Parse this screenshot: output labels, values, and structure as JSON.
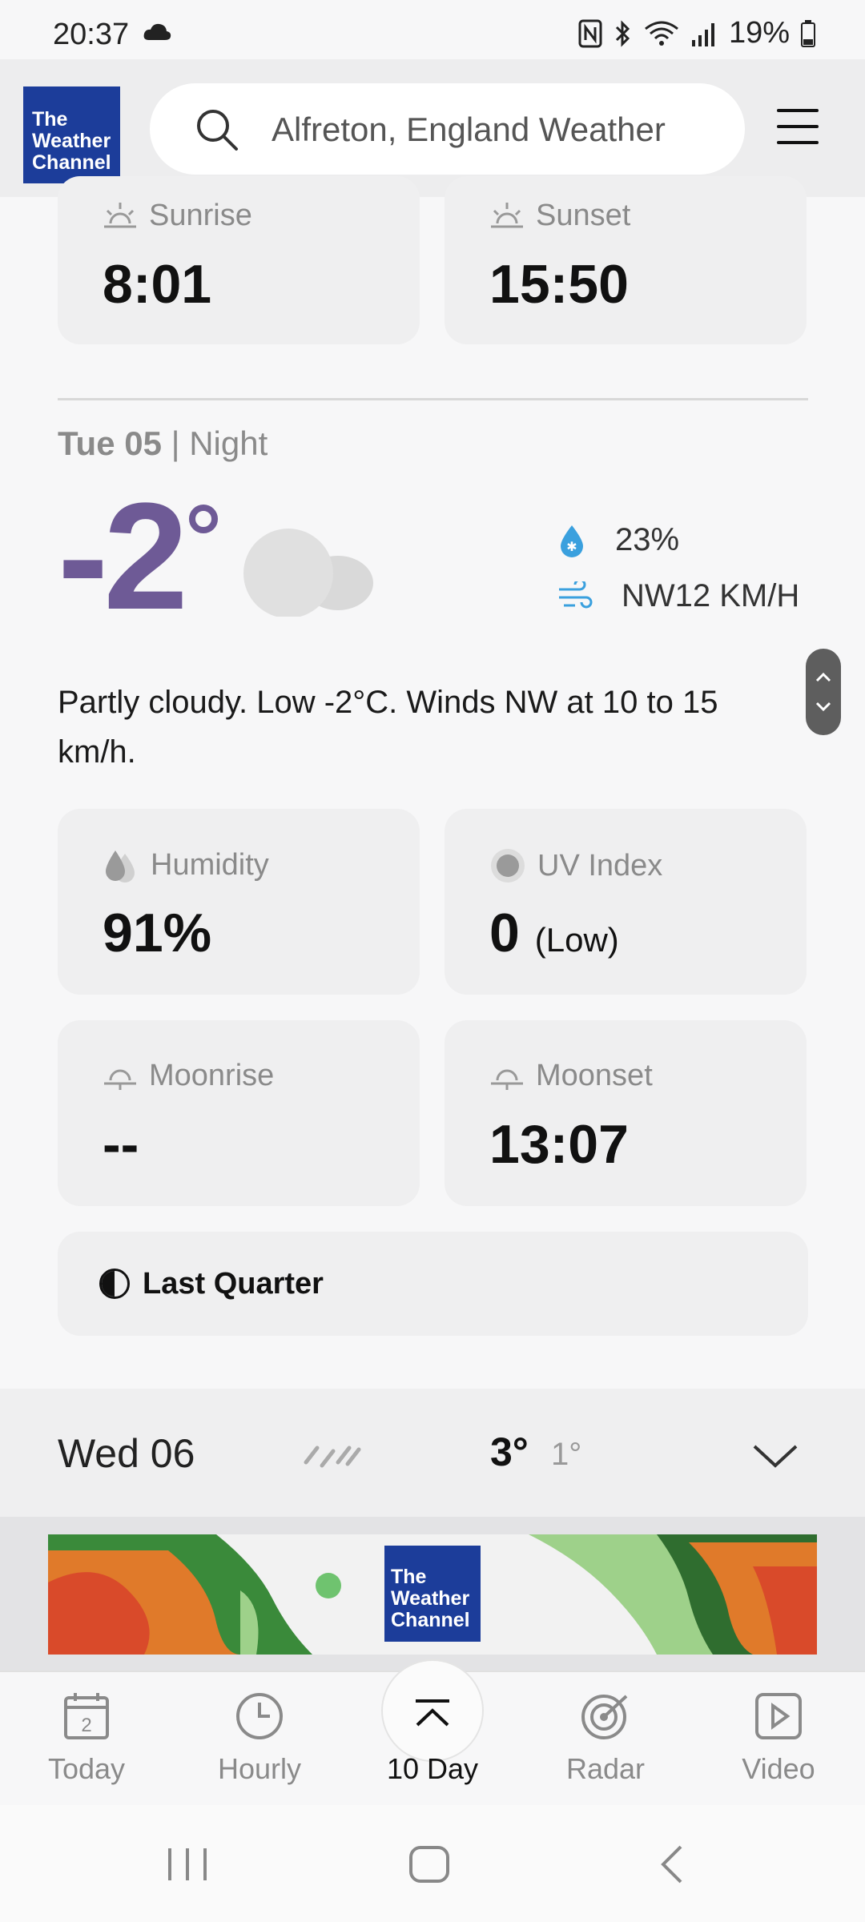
{
  "status_bar": {
    "time": "20:37",
    "battery": "19%"
  },
  "header": {
    "search_text": "Alfreton, England Weather",
    "logo_lines": [
      "The",
      "Weather",
      "Channel"
    ]
  },
  "sun": {
    "sunrise_label": "Sunrise",
    "sunrise_value": "8:01",
    "sunset_label": "Sunset",
    "sunset_value": "15:50"
  },
  "night": {
    "day": "Tue 05",
    "period": "Night",
    "temperature": "-2",
    "precip": "23%",
    "wind": "NW12 KM/H",
    "description": "Partly cloudy. Low -2°C. Winds NW at 10 to 15 km/h.",
    "humidity_label": "Humidity",
    "humidity_value": "91%",
    "uv_label": "UV Index",
    "uv_value": "0",
    "uv_desc": "(Low)",
    "moonrise_label": "Moonrise",
    "moonrise_value": "--",
    "moonset_label": "Moonset",
    "moonset_value": "13:07",
    "moon_phase": "Last Quarter"
  },
  "next_day": {
    "label": "Wed 06",
    "high": "3°",
    "low": "1°"
  },
  "tabs": [
    {
      "label": "Today",
      "icon": "calendar-icon",
      "badge": "2"
    },
    {
      "label": "Hourly",
      "icon": "clock-icon"
    },
    {
      "label": "10 Day",
      "icon": "chevron-up-icon"
    },
    {
      "label": "Radar",
      "icon": "radar-icon"
    },
    {
      "label": "Video",
      "icon": "video-icon"
    }
  ],
  "colors": {
    "temperature": "#6e5a96",
    "brand": "#1c3d9a",
    "moon": "#b57ee6"
  }
}
